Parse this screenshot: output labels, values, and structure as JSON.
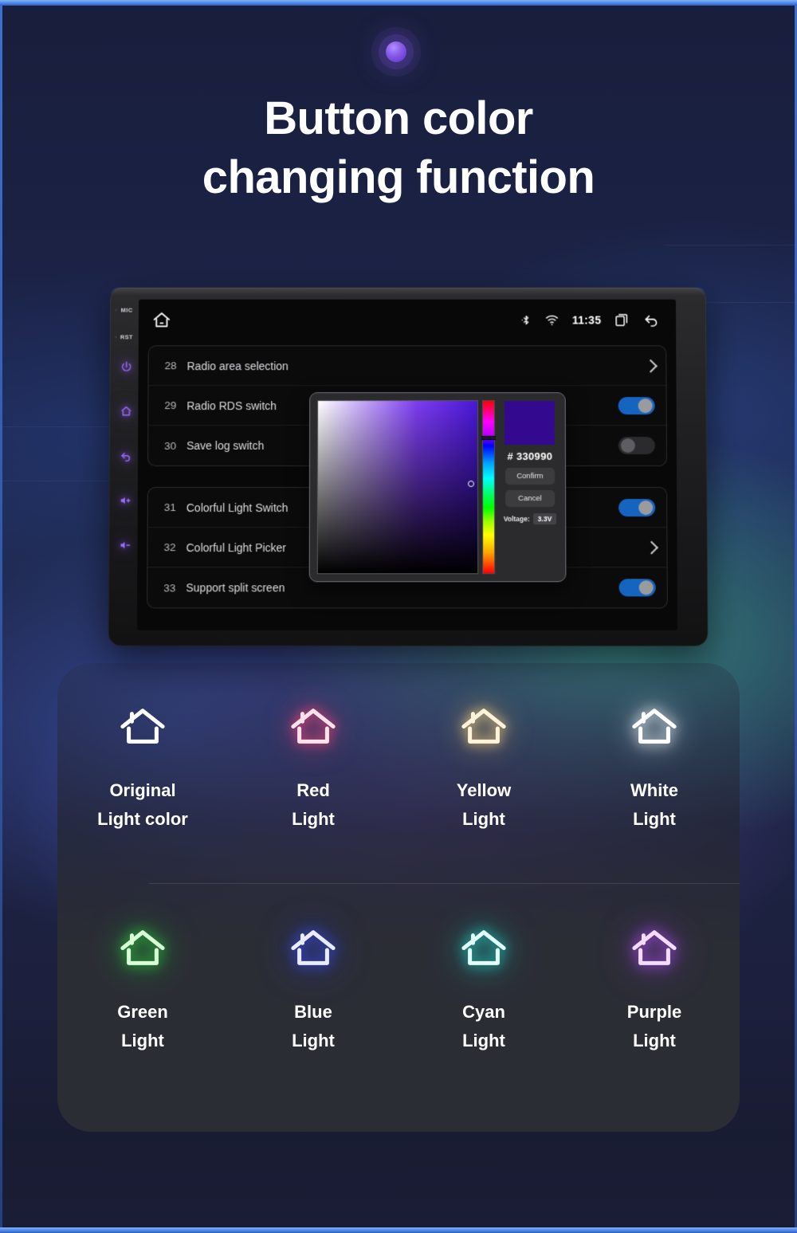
{
  "heading": {
    "line1": "Button color",
    "line2": "changing function"
  },
  "decor": {
    "top_dot": "glow-dot",
    "accent": "#8457e8"
  },
  "device": {
    "rail": {
      "mic_label": "MIC",
      "rst_label": "RST",
      "buttons": [
        {
          "name": "power-button",
          "icon": "power-icon"
        },
        {
          "name": "home-button",
          "icon": "home-icon"
        },
        {
          "name": "back-button",
          "icon": "back-arrow-icon"
        },
        {
          "name": "volume-up-button",
          "icon": "volume-up-icon"
        },
        {
          "name": "volume-down-button",
          "icon": "volume-down-icon"
        }
      ],
      "glow_color": "#9a6cff"
    },
    "statusbar": {
      "home_icon": "home-icon",
      "bluetooth_icon": "bluetooth-icon",
      "wifi_icon": "wifi-icon",
      "time": "11:35",
      "recents_icon": "recent-apps-icon",
      "back_icon": "back-arrow-icon"
    },
    "settings_groups": [
      {
        "rows": [
          {
            "num": "28",
            "label": "Radio area selection",
            "control": "chevron"
          },
          {
            "num": "29",
            "label": "Radio RDS switch",
            "control": "toggle",
            "on": true
          },
          {
            "num": "30",
            "label": "Save log switch",
            "control": "toggle",
            "on": false
          }
        ]
      },
      {
        "rows": [
          {
            "num": "31",
            "label": "Colorful Light Switch",
            "control": "toggle",
            "on": true
          },
          {
            "num": "32",
            "label": "Colorful Light Picker",
            "control": "chevron"
          },
          {
            "num": "33",
            "label": "Support split screen",
            "control": "toggle",
            "on": true
          }
        ]
      }
    ],
    "color_picker": {
      "hash_symbol": "#",
      "hex_value": "330990",
      "swatch_color": "#330990",
      "confirm_label": "Confirm",
      "cancel_label": "Cancel",
      "voltage_label": "Voltage:",
      "voltage_value": "3.3V"
    }
  },
  "light_colors": [
    {
      "caption_line1": "Original",
      "caption_line2": "Light color",
      "color": "#ffffff",
      "glow": "rgba(255,255,255,0.0)"
    },
    {
      "caption_line1": "Red",
      "caption_line2": "Light",
      "color": "#ffe3e8",
      "glow": "rgba(255,70,120,0.85)"
    },
    {
      "caption_line1": "Yellow",
      "caption_line2": "Light",
      "color": "#fff3da",
      "glow": "rgba(255,214,130,0.85)"
    },
    {
      "caption_line1": "White",
      "caption_line2": "Light",
      "color": "#ffffff",
      "glow": "rgba(255,255,255,0.9)"
    },
    {
      "caption_line1": "Green",
      "caption_line2": "Light",
      "color": "#d9ffd9",
      "glow": "rgba(40,220,60,0.9)"
    },
    {
      "caption_line1": "Blue",
      "caption_line2": "Light",
      "color": "#e9ecff",
      "glow": "rgba(60,80,255,0.95)"
    },
    {
      "caption_line1": "Cyan",
      "caption_line2": "Light",
      "color": "#e2fffb",
      "glow": "rgba(30,230,215,0.9)"
    },
    {
      "caption_line1": "Purple",
      "caption_line2": "Light",
      "color": "#f3dcff",
      "glow": "rgba(185,80,255,0.9)"
    }
  ]
}
